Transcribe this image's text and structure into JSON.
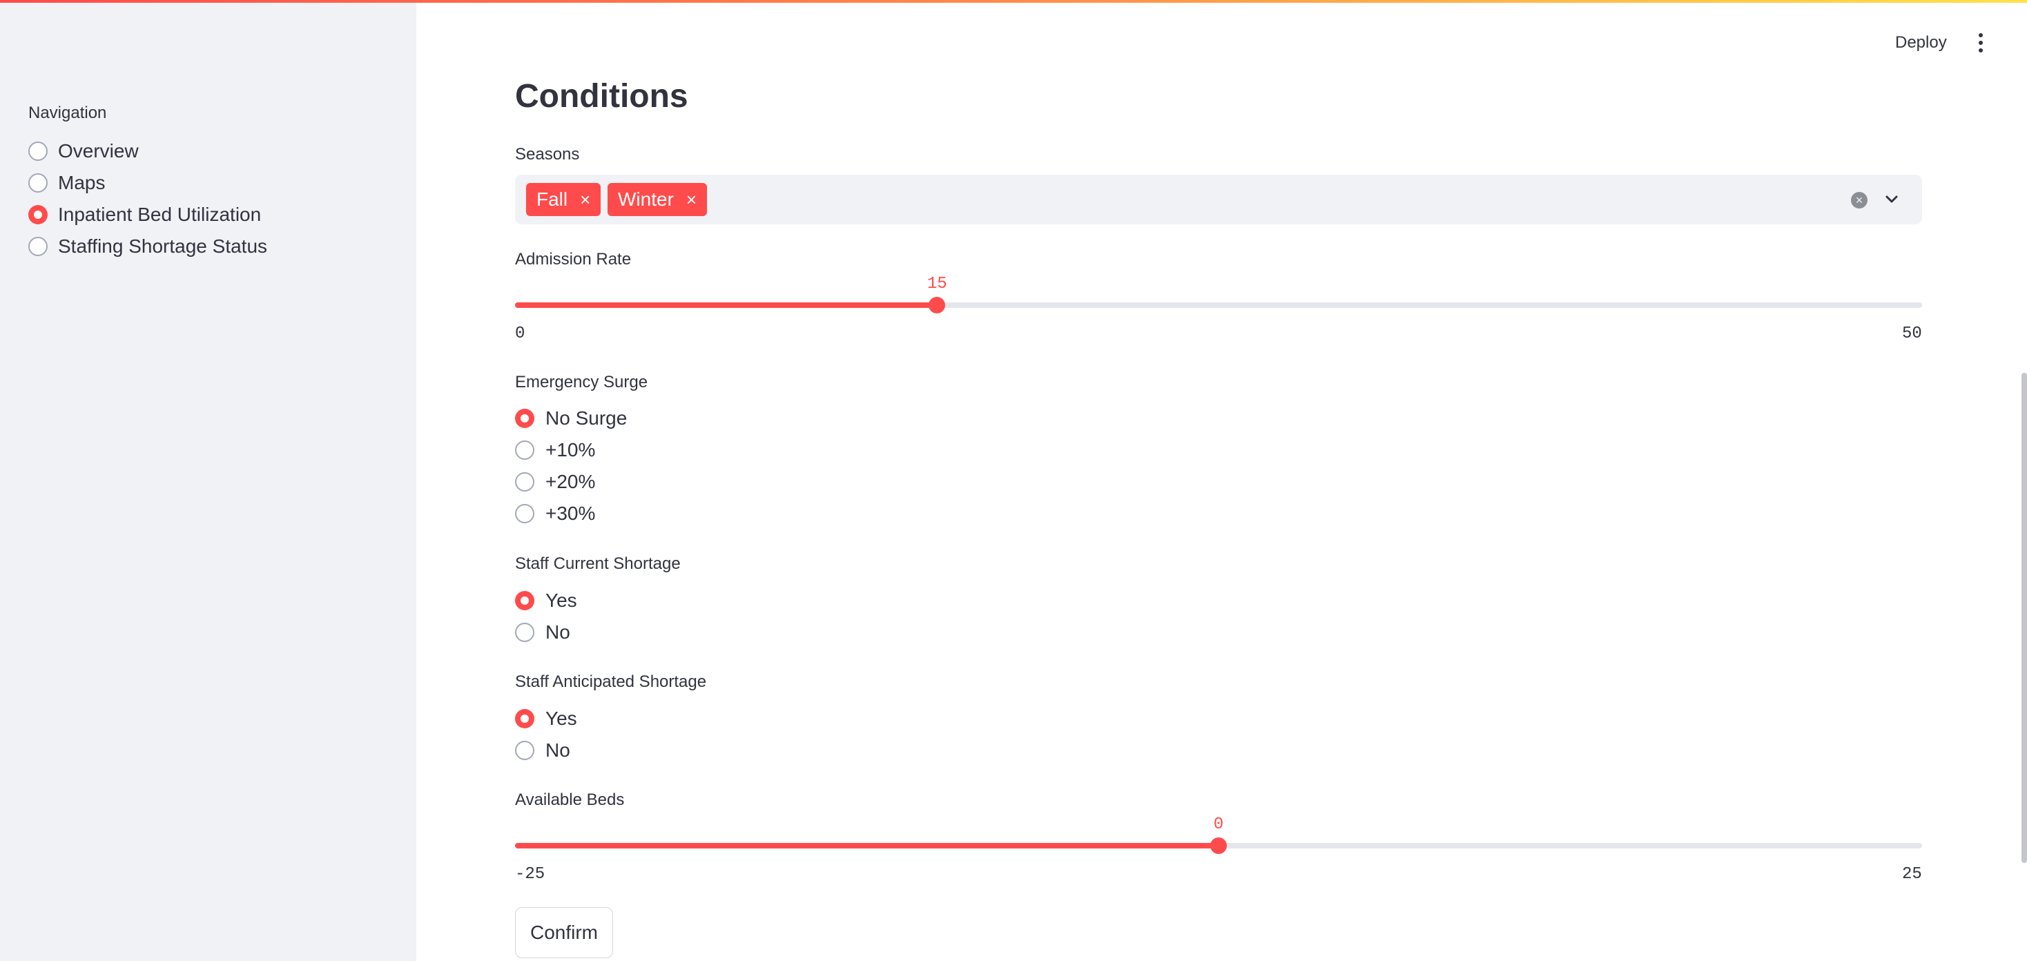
{
  "header": {
    "deploy_label": "Deploy",
    "menu_icon": "kebab-menu-icon"
  },
  "sidebar": {
    "title": "Navigation",
    "items": [
      {
        "label": "Overview",
        "selected": false
      },
      {
        "label": "Maps",
        "selected": false
      },
      {
        "label": "Inpatient Bed Utilization",
        "selected": true
      },
      {
        "label": "Staffing Shortage Status",
        "selected": false
      }
    ]
  },
  "main": {
    "title": "Conditions",
    "seasons": {
      "label": "Seasons",
      "selected": [
        "Fall",
        "Winter"
      ],
      "close_glyph": "×",
      "clear_glyph": "×"
    },
    "admission_rate": {
      "label": "Admission Rate",
      "value": "15",
      "min": "0",
      "max": "50"
    },
    "emergency_surge": {
      "label": "Emergency Surge",
      "options": [
        "No Surge",
        "+10%",
        "+20%",
        "+30%"
      ],
      "selected": "No Surge"
    },
    "staff_current_shortage": {
      "label": "Staff Current Shortage",
      "options": [
        "Yes",
        "No"
      ],
      "selected": "Yes"
    },
    "staff_anticipated_shortage": {
      "label": "Staff Anticipated Shortage",
      "options": [
        "Yes",
        "No"
      ],
      "selected": "Yes"
    },
    "available_beds": {
      "label": "Available Beds",
      "value": "0",
      "min": "-25",
      "max": "25"
    },
    "confirm_label": "Confirm"
  },
  "colors": {
    "accent": "#ff4b4b",
    "sidebar_bg": "#f0f2f6",
    "text": "#31333f"
  }
}
